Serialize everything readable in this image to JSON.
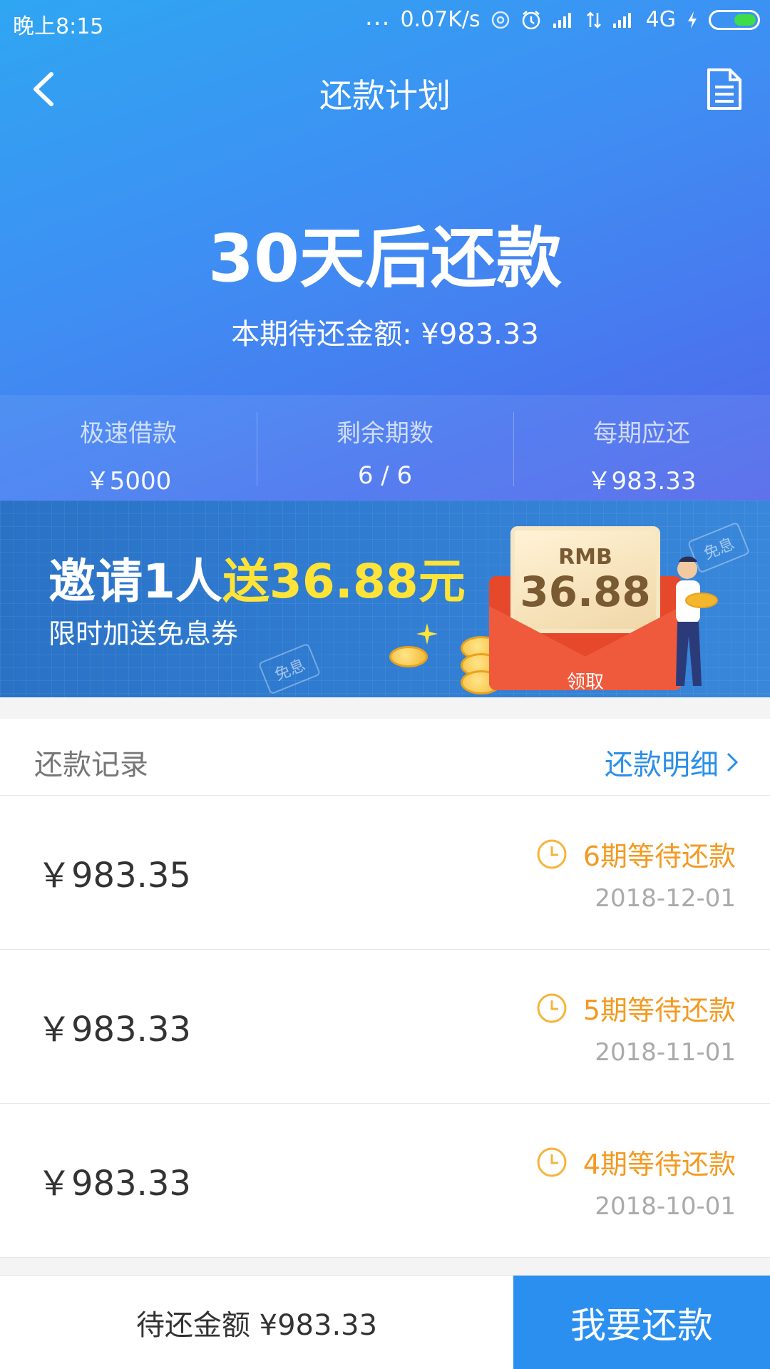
{
  "status_bar": {
    "time": "晚上8:15",
    "dots": "...",
    "net_speed": "0.07K/s",
    "network": "4G",
    "battery_color": "#3fdc4a"
  },
  "nav": {
    "title": "还款计划",
    "back_icon": "chevron-left-icon",
    "doc_icon": "document-icon"
  },
  "summary": {
    "headline": "30天后还款",
    "current_due": "本期待还金额: ¥983.33"
  },
  "stats": [
    {
      "label": "极速借款",
      "value": "￥5000"
    },
    {
      "label": "剩余期数",
      "value": "6 / 6"
    },
    {
      "label": "每期应还",
      "value": "￥983.33"
    }
  ],
  "banner": {
    "headline_prefix": "邀请1人",
    "headline_highlight": "送36.88元",
    "subtitle": "限时加送免息券",
    "ticket_text": "免息",
    "envelope_currency": "RMB",
    "envelope_amount": "36.88",
    "envelope_button": "领取"
  },
  "records": {
    "title": "还款记录",
    "detail_link": "还款明细",
    "items": [
      {
        "amount": "￥983.35",
        "status": "6期等待还款",
        "date": "2018-12-01"
      },
      {
        "amount": "￥983.33",
        "status": "5期等待还款",
        "date": "2018-11-01"
      },
      {
        "amount": "￥983.33",
        "status": "4期等待还款",
        "date": "2018-10-01"
      }
    ]
  },
  "bottom": {
    "pending_label": "待还金额 ¥983.33",
    "pay_button": "我要还款"
  },
  "colors": {
    "accent": "#2b8ff0",
    "status_orange": "#f39a22",
    "banner_highlight": "#ffe437"
  }
}
